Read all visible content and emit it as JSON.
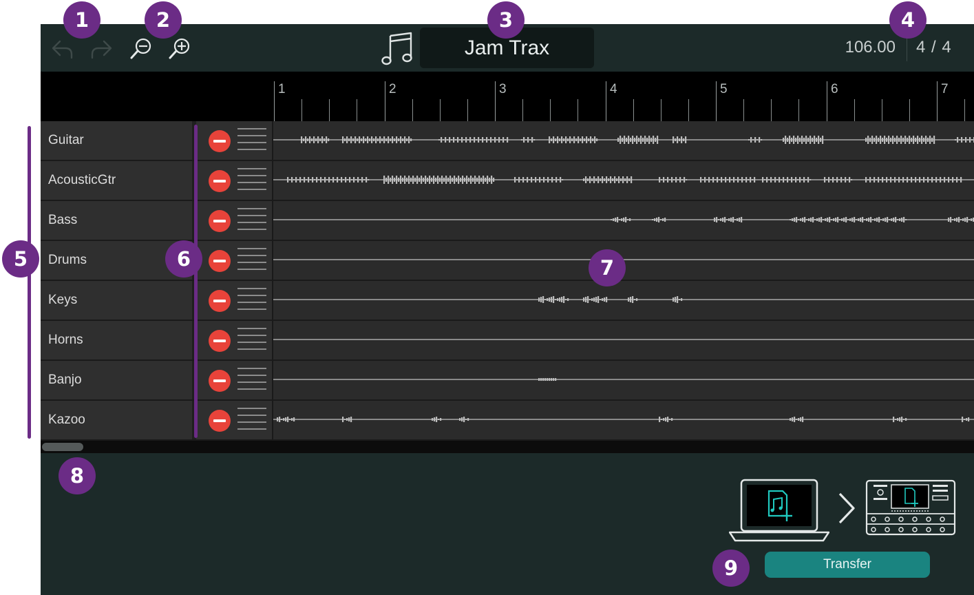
{
  "header": {
    "title": "Jam Trax",
    "tempo": "106.00",
    "time_signature": "4 / 4",
    "undo_icon": "undo-icon",
    "redo_icon": "redo-icon",
    "zoom_out_icon": "zoom-out-icon",
    "zoom_in_icon": "zoom-in-icon",
    "song_icon": "music-note-icon"
  },
  "ruler": {
    "measures": [
      "1",
      "2",
      "3",
      "4",
      "5",
      "6",
      "7"
    ]
  },
  "tracks": [
    {
      "name": "Guitar"
    },
    {
      "name": "AcousticGtr"
    },
    {
      "name": "Bass"
    },
    {
      "name": "Drums"
    },
    {
      "name": "Keys"
    },
    {
      "name": "Horns"
    },
    {
      "name": "Banjo"
    },
    {
      "name": "Kazoo"
    }
  ],
  "track_controls": {
    "mute_icon": "remove-track-icon",
    "reorder_icon": "drag-handle-icon"
  },
  "transfer": {
    "button_label": "Transfer",
    "source_icon": "laptop-icon",
    "arrow_icon": "chevron-right-icon",
    "target_icon": "hardware-unit-icon"
  },
  "annotations": [
    "1",
    "2",
    "3",
    "4",
    "5",
    "6",
    "7",
    "8",
    "9"
  ],
  "colors": {
    "background": "#1c2a29",
    "accent": "#1a8480",
    "mute": "#e8433a",
    "annotation": "#6b2c86"
  }
}
